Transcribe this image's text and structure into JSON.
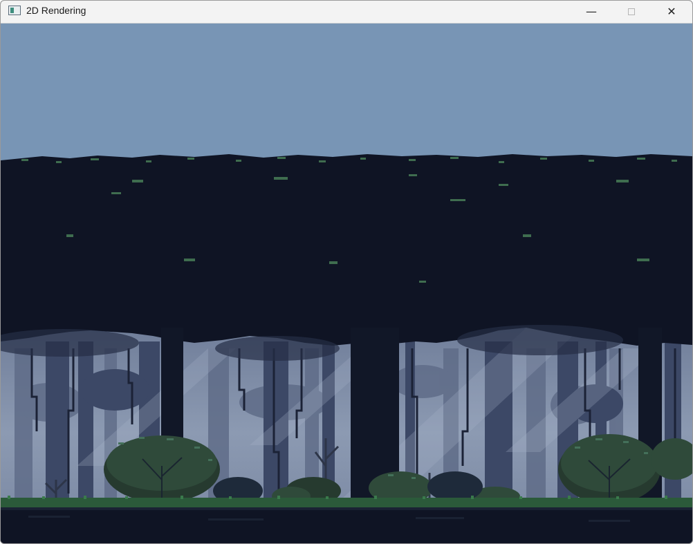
{
  "window": {
    "title": "2D Rendering",
    "controls": {
      "minimize": "—",
      "close": "✕"
    }
  },
  "scene": {
    "type": "pixel-art forest",
    "colors": {
      "sky": "#7895b5",
      "canopy": "#0f1424",
      "canopy_highlight": "#3f6d4f",
      "mist": "#8594ac",
      "bg_trees": "#3c4866",
      "far_trees": "#5a6784",
      "trunk": "#111727",
      "bush": "#263a2f",
      "bush_leaf": "#44705a",
      "grass": "#2b5a3a",
      "ground": "#0f1424",
      "light_ray": "#a7b3c8"
    }
  }
}
